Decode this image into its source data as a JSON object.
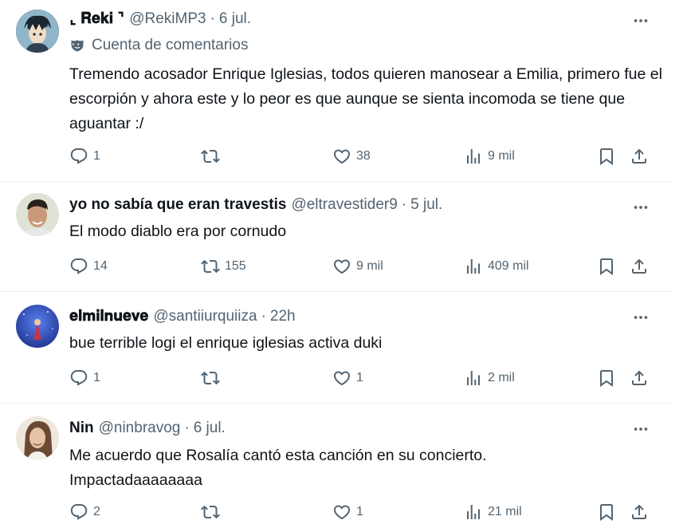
{
  "tweets": [
    {
      "name": "⌞ 𝐑𝐞𝐤𝐢 ⌝",
      "handle": "@RekiMP3",
      "time": "6 jul.",
      "badge": "Cuenta de comentarios",
      "text": "Tremendo acosador Enrique Iglesias, todos quieren manosear a Emilia, primero fue el escorpión y ahora este y lo peor es que aunque se sienta incomoda se tiene que aguantar :/",
      "replies": "1",
      "retweets": "",
      "likes": "38",
      "views": "9 mil"
    },
    {
      "name": "yo no sabía que eran travestis",
      "handle": "@eltravestider9",
      "time": "5 jul.",
      "text": "El modo diablo era por cornudo",
      "replies": "14",
      "retweets": "155",
      "likes": "9 mil",
      "views": "409 mil"
    },
    {
      "name": "𝐞𝐥𝐦𝐢𝐥𝐧𝐮𝐞𝐯𝐞",
      "handle": "@santiiurquiiza",
      "time": "22h",
      "text": "bue terrible logi el enrique iglesias activa duki",
      "replies": "1",
      "retweets": "",
      "likes": "1",
      "views": "2 mil"
    },
    {
      "name": "Nin",
      "handle": "@ninbravog",
      "time": "6 jul.",
      "text": "Me acuerdo que Rosalía cantó esta canción en su concierto. Impactadaaaaaaaa",
      "replies": "2",
      "retweets": "",
      "likes": "1",
      "views": "21 mil"
    }
  ],
  "separator": "·"
}
